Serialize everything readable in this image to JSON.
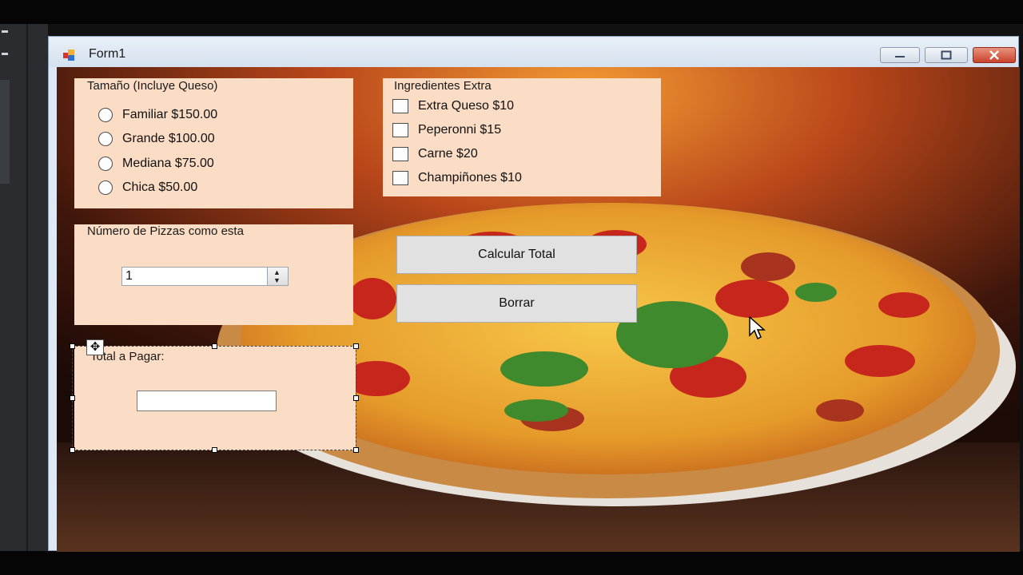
{
  "window": {
    "title": "Form1",
    "controls": {
      "minimize": "minimize",
      "maximize": "maximize",
      "close": "close"
    }
  },
  "size_group": {
    "title": "Tamaño (Incluye Queso)",
    "options": [
      {
        "label": "Familiar $150.00",
        "selected": false
      },
      {
        "label": "Grande $100.00",
        "selected": false
      },
      {
        "label": "Mediana $75.00",
        "selected": false
      },
      {
        "label": "Chica $50.00",
        "selected": false
      }
    ]
  },
  "extras_group": {
    "title": "Ingredientes Extra",
    "options": [
      {
        "label": "Extra Queso $10",
        "checked": false
      },
      {
        "label": "Peperonni $15",
        "checked": false
      },
      {
        "label": "Carne $20",
        "checked": false
      },
      {
        "label": "Champiñones $10",
        "checked": false
      }
    ]
  },
  "quantity_group": {
    "title": "Número de Pizzas como esta",
    "value": "1"
  },
  "buttons": {
    "calculate": "Calcular Total",
    "clear": "Borrar"
  },
  "total_group": {
    "title": "Total a Pagar:",
    "value": ""
  },
  "colors": {
    "group_bg": "#fbdcc5",
    "button_bg": "#e1e1e1",
    "close_red": "#c9432b"
  },
  "icons": [
    "form-icon",
    "minimize-icon",
    "maximize-icon",
    "close-icon",
    "spin-up-icon",
    "spin-down-icon",
    "move-handle-icon",
    "arrow-cursor-icon"
  ]
}
